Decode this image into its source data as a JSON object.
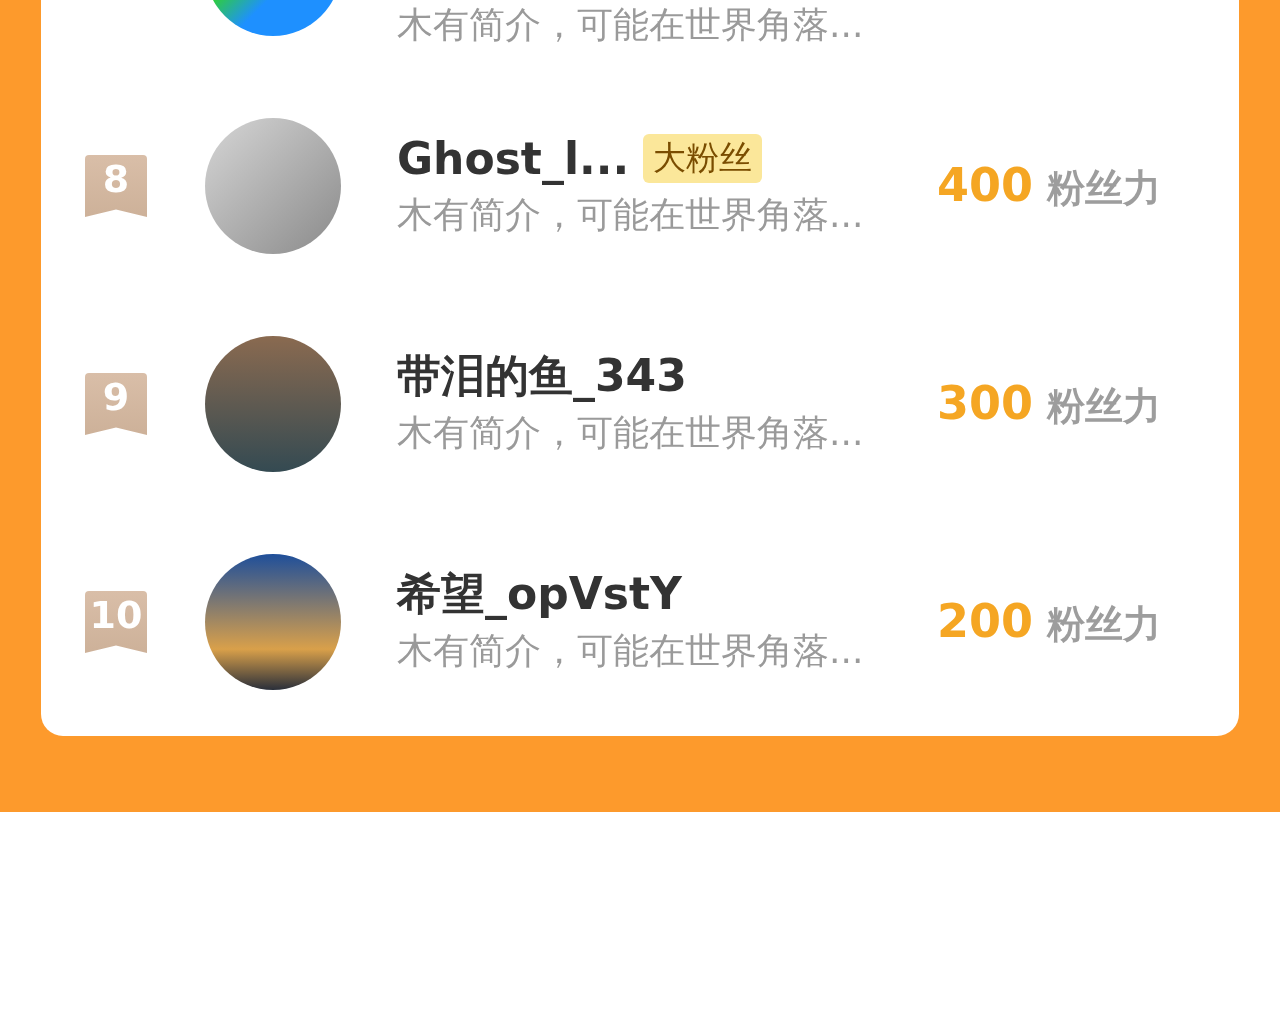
{
  "rows": [
    {
      "kind": "clipped",
      "bio": "木有简介，可能在世界角落..."
    },
    {
      "kind": "full",
      "rank": "8",
      "name": "Ghost_l...",
      "badge": "大粉丝",
      "bio": "木有简介，可能在世界角落...",
      "score": "400",
      "score_unit": "粉丝力"
    },
    {
      "kind": "full",
      "rank": "9",
      "name": "带泪的鱼_343",
      "bio": "木有简介，可能在世界角落...",
      "score": "300",
      "score_unit": "粉丝力"
    },
    {
      "kind": "full",
      "rank": "10",
      "name": "希望_opVstY",
      "bio": "木有简介，可能在世界角落...",
      "score": "200",
      "score_unit": "粉丝力"
    }
  ]
}
